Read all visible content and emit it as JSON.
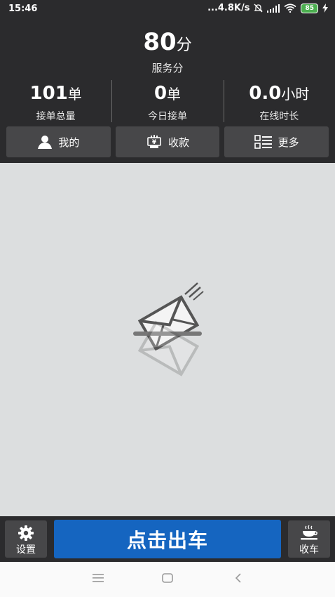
{
  "status_bar": {
    "time": "15:46",
    "network_speed": "...4.8K/s",
    "battery_level": "85"
  },
  "header": {
    "score_value": "80",
    "score_unit": "分",
    "score_label": "服务分",
    "stats": [
      {
        "value": "101",
        "unit": "单",
        "label": "接单总量"
      },
      {
        "value": "0",
        "unit": "单",
        "label": "今日接单"
      },
      {
        "value": "0.0",
        "unit": "小时",
        "label": "在线时长"
      }
    ],
    "nav": [
      {
        "label": "我的",
        "icon": "person-icon"
      },
      {
        "label": "收款",
        "icon": "payment-icon"
      },
      {
        "label": "更多",
        "icon": "list-icon"
      }
    ]
  },
  "main": {
    "empty_icon": "envelope-icon"
  },
  "bottom_bar": {
    "settings_label": "设置",
    "depart_label": "点击出车",
    "offline_label": "收车"
  },
  "system_nav": {
    "icons": [
      "menu-icon",
      "home-icon",
      "back-icon"
    ]
  },
  "colors": {
    "header_bg": "#2b2b2d",
    "button_bg": "#474749",
    "primary": "#1565c0",
    "main_bg": "#dcdedf",
    "battery": "#4caf50"
  }
}
